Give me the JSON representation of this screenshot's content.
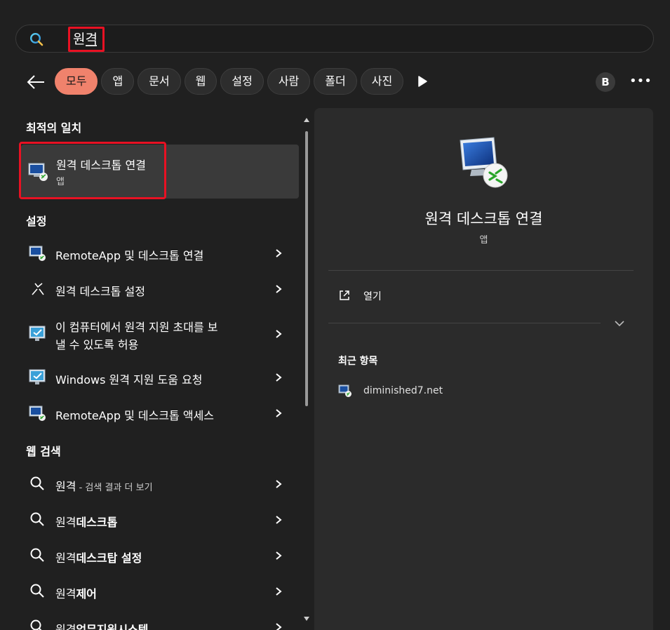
{
  "search": {
    "query": "원격"
  },
  "filters": [
    "모두",
    "앱",
    "문서",
    "웹",
    "설정",
    "사람",
    "폴더",
    "사진"
  ],
  "account_initial": "B",
  "more_label": "•••",
  "sections": {
    "best_match": "최적의 일치",
    "settings": "설정",
    "web_search": "웹 검색"
  },
  "best_match": {
    "title": "원격 데스크톱 연결",
    "type": "앱"
  },
  "settings_items": [
    {
      "label": "RemoteApp 및 데스크톱 연결",
      "icon": "remoteapp-icon"
    },
    {
      "label": "원격 데스크톱 설정",
      "icon": "remote-desktop-settings-icon"
    },
    {
      "label_line1": "이 컴퓨터에서 원격 지원 초대를 보",
      "label_line2": "낼 수 있도록 허용",
      "icon": "remote-assistance-icon"
    },
    {
      "label": "Windows 원격 지원 도움 요청",
      "icon": "remote-assistance-icon"
    },
    {
      "label": "RemoteApp 및 데스크톱 액세스",
      "icon": "remoteapp-icon"
    }
  ],
  "web_items": [
    {
      "prefix": "원격",
      "suffix": " - 검색 결과 더 보기",
      "bold": ""
    },
    {
      "prefix": "원격",
      "suffix": "",
      "bold": "데스크톱"
    },
    {
      "prefix": "원격",
      "suffix": "",
      "bold": "데스크탑 설정"
    },
    {
      "prefix": "원격",
      "suffix": "",
      "bold": "제어"
    },
    {
      "prefix": "원격",
      "suffix": "",
      "bold": "업무지원시스템"
    }
  ],
  "details": {
    "title": "원격 데스크톱 연결",
    "type": "앱",
    "open_label": "열기",
    "recent_title": "최근 항목",
    "recent_items": [
      "diminished7.net"
    ]
  },
  "colors": {
    "accent_chip": "#f0826c",
    "highlight_box": "#e81123",
    "background": "#202020",
    "panel": "#2b2b2b"
  }
}
